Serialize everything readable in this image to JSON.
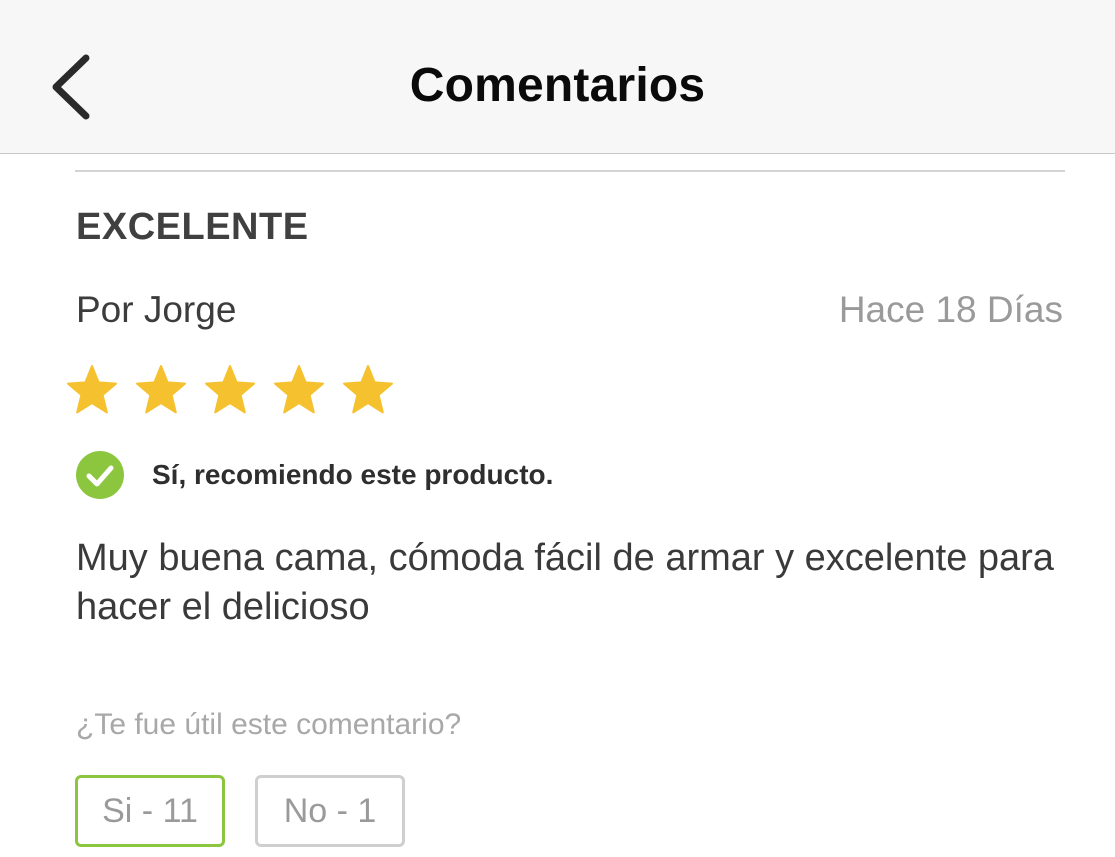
{
  "header": {
    "title": "Comentarios",
    "back_icon": "chevron-left-icon"
  },
  "review": {
    "title": "EXCELENTE",
    "author": "Por Jorge",
    "date": "Hace 18 Días",
    "rating": 5,
    "rating_max": 5,
    "star_color": "#f5c12e",
    "recommend_text": "Sí, recomiendo este producto.",
    "recommend_icon": "check-circle-icon",
    "recommend_color": "#8cc63f",
    "body": "Muy buena cama, cómoda fácil de armar y excelente para hacer el delicioso"
  },
  "helpful": {
    "question": "¿Te fue útil este comentario?",
    "yes_label": "Si - 11",
    "no_label": "No - 1",
    "yes_border_color": "#8cc63f"
  }
}
